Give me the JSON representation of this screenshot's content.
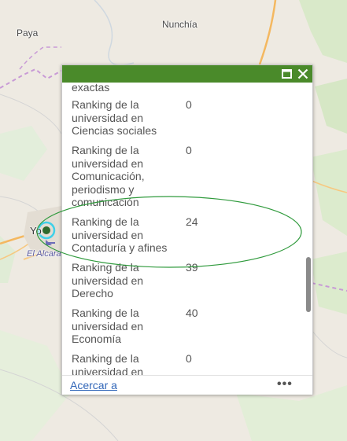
{
  "map": {
    "labels": {
      "paya": "Paya",
      "nunchia": "Nunchía",
      "yopal_partial": "Yo",
      "el_alcaraban_partial": "El Alcara"
    },
    "colors": {
      "land": "#eeeae2",
      "roads": "#f4b860",
      "boundary": "#c89ad6",
      "vegetation": "#d5e8c4",
      "marker_ring": "#3fd0e8",
      "marker_center": "#2d6a2d",
      "highlight_ellipse": "#2f9a3c"
    }
  },
  "popup": {
    "header_color": "#4a8a2a",
    "partial_top_text": "exactas",
    "rows": [
      {
        "label": "Ranking de la universidad en Ciencias sociales",
        "value": "0"
      },
      {
        "label": "Ranking de la universidad en Comunicación, periodismo y comunicación",
        "value": "0"
      },
      {
        "label": "Ranking de la universidad en Contaduría y afines",
        "value": "24"
      },
      {
        "label": "Ranking de la universidad en Derecho",
        "value": "39"
      },
      {
        "label": "Ranking de la universidad en Economía",
        "value": "40"
      },
      {
        "label": "Ranking de la universidad en",
        "value": "0"
      }
    ],
    "footer": {
      "zoom_link": "Acercar a",
      "more_icon": "•••"
    },
    "icons": [
      "maximize-icon",
      "close-icon"
    ]
  }
}
